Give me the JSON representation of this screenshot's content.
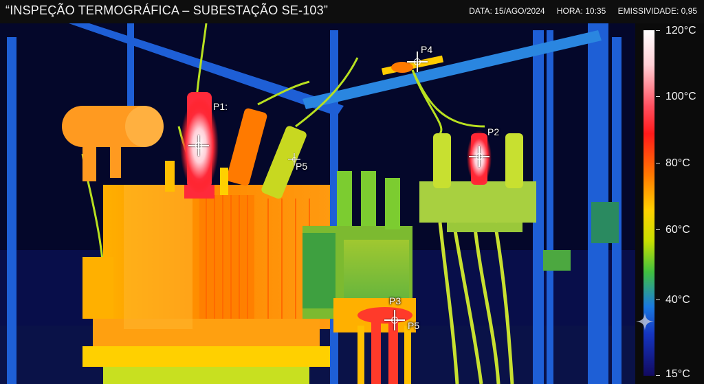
{
  "header": {
    "title": "“INSPEÇÃO TERMOGRÁFICA – SUBESTAÇÃO SE-103”",
    "date": "DATA: 15/AGO/2024",
    "time": "HORA: 10:35",
    "emissivity": "EMISSIVIDADE: 0,95"
  },
  "scale": {
    "labels": [
      "120°C",
      "100°C",
      "80°C",
      "60°C",
      "40°C",
      "15°C"
    ],
    "colors": [
      "#ffffff",
      "#ff1a1a",
      "#ff7a00",
      "#ffd000",
      "#40c040",
      "#1a7ae0",
      "#120a60"
    ]
  },
  "points": {
    "p1": "P1:",
    "p2": "P2",
    "p3": "P3",
    "p4": "P4",
    "p5a": "P5",
    "p5b": "P5"
  },
  "icons": {
    "sparkle": "sparkle-icon",
    "crosshair": "crosshair-icon"
  }
}
